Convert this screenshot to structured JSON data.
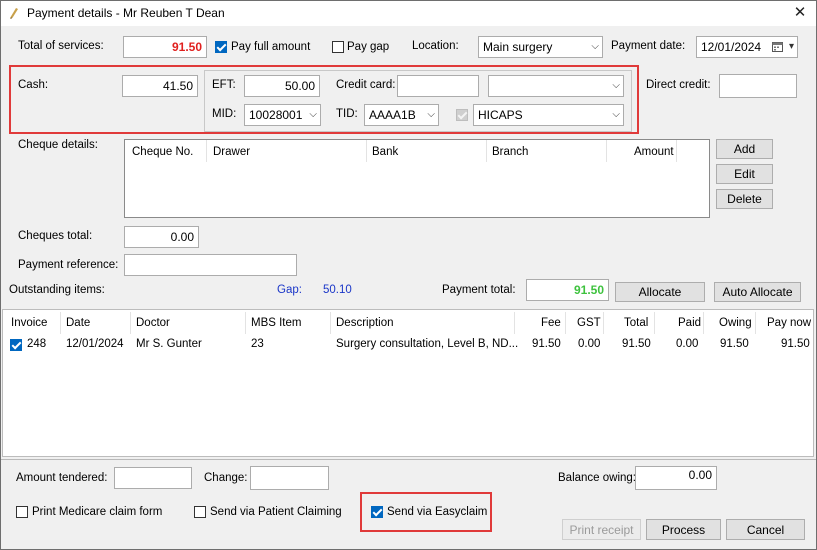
{
  "window": {
    "title": "Payment details - Mr Reuben T Dean",
    "close_glyph": "✕"
  },
  "top": {
    "total_label": "Total of services:",
    "total_value": "91.50",
    "pay_full_label": "Pay full amount",
    "pay_gap_label": "Pay gap",
    "location_label": "Location:",
    "location_value": "Main surgery",
    "payment_date_label": "Payment date:",
    "payment_date_value": "12/01/2024"
  },
  "payment": {
    "cash_label": "Cash:",
    "cash_value": "41.50",
    "eft_label": "EFT:",
    "eft_value": "50.00",
    "credit_card_label": "Credit card:",
    "credit_card_value": "",
    "card_type_value": "",
    "direct_credit_label": "Direct credit:",
    "direct_credit_value": "",
    "mid_label": "MID:",
    "mid_value": "10028001",
    "tid_label": "TID:",
    "tid_value": "AAAA1B",
    "terminal_value": "HICAPS"
  },
  "cheques": {
    "label": "Cheque details:",
    "columns": [
      "Cheque No.",
      "Drawer",
      "Bank",
      "Branch",
      "Amount"
    ],
    "add_label": "Add",
    "edit_label": "Edit",
    "delete_label": "Delete",
    "total_label": "Cheques total:",
    "total_value": "0.00"
  },
  "reference": {
    "label": "Payment reference:",
    "value": ""
  },
  "outstanding": {
    "label": "Outstanding items:",
    "gap_label": "Gap:",
    "gap_value": "50.10",
    "payment_total_label": "Payment total:",
    "payment_total_value": "91.50",
    "allocate_label": "Allocate",
    "auto_allocate_label": "Auto Allocate"
  },
  "items": {
    "columns": [
      "Invoice",
      "Date",
      "Doctor",
      "MBS Item",
      "Description",
      "Fee",
      "GST",
      "Total",
      "Paid",
      "Owing",
      "Pay now"
    ],
    "rows": [
      {
        "invoice": "248",
        "date": "12/01/2024",
        "doctor": "Mr S. Gunter",
        "mbs": "23",
        "description": "Surgery consultation, Level B, ND...",
        "fee": "91.50",
        "gst": "0.00",
        "total": "91.50",
        "paid": "0.00",
        "owing": "91.50",
        "paynow": "91.50",
        "checked": true
      }
    ]
  },
  "bottom": {
    "amount_tendered_label": "Amount tendered:",
    "amount_tendered_value": "",
    "change_label": "Change:",
    "change_value": "",
    "balance_label": "Balance owing:",
    "balance_value": "0.00",
    "print_medicare_label": "Print Medicare claim form",
    "patient_claiming_label": "Send via Patient Claiming",
    "easyclaim_label": "Send via Easyclaim",
    "print_receipt_label": "Print receipt",
    "process_label": "Process",
    "cancel_label": "Cancel"
  },
  "colors": {
    "total_red": "#e0201e",
    "payment_total_green": "#3ec23e",
    "gap_blue": "#1a36c8",
    "highlight_red": "#e03a3a",
    "check_blue": "#0067c0"
  }
}
